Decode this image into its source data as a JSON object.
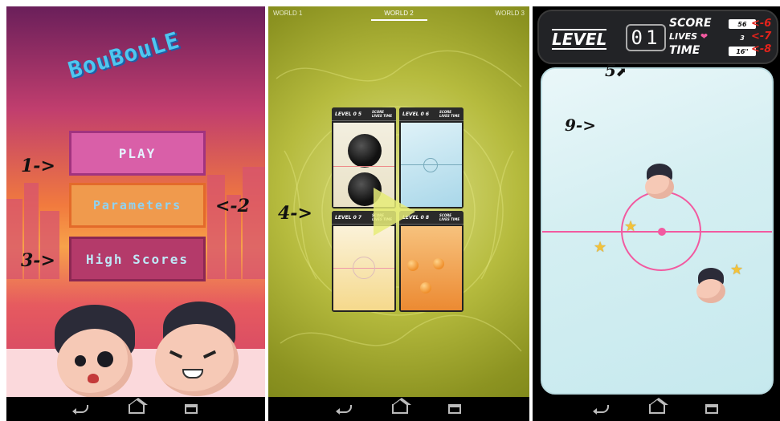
{
  "panel1": {
    "logo": "BouBouLE",
    "buttons": {
      "play": "PLAY",
      "parameters": "Parameters",
      "high_scores": "High Scores"
    },
    "annotations": {
      "a1": "1->",
      "a2": "<-2",
      "a3": "3->"
    }
  },
  "panel2": {
    "tabs": [
      "WORLD 1",
      "WORLD 2",
      "WORLD 3"
    ],
    "active_tab": "WORLD 2",
    "annotation": "4->",
    "levels": [
      {
        "level_label": "LEVEL 0 5",
        "hud": "SCORE LIVES TIME"
      },
      {
        "level_label": "LEVEL 0 6",
        "hud": "SCORE LIVES TIME"
      },
      {
        "level_label": "LEVEL 0 7",
        "hud": "SCORE LIVES TIME"
      },
      {
        "level_label": "LEVEL 0 8",
        "hud": "SCORE LIVES TIME"
      }
    ]
  },
  "panel3": {
    "hud": {
      "level_label": "LEVEL",
      "level_value": "01",
      "score_label": "SCORE",
      "score_value": "56",
      "lives_label": "LIVES",
      "lives_value": "3",
      "time_label": "TIME",
      "time_value": "16\""
    },
    "annotations": {
      "a5": "5",
      "a6": "<-6",
      "a7": "<-7",
      "a8": "<-8",
      "a9": "9->"
    }
  },
  "colors": {
    "accent_red": "#e3231c",
    "rink_line": "#f25aa0"
  }
}
